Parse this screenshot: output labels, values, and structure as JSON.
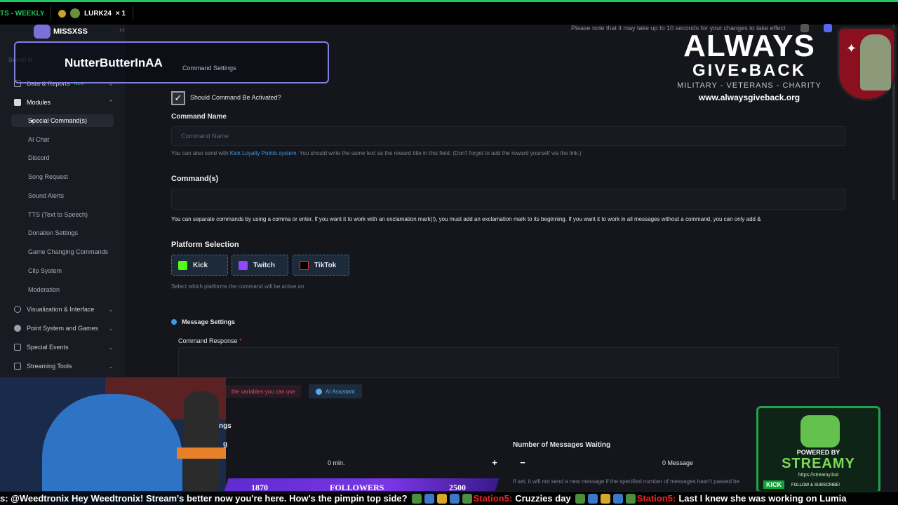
{
  "topbar": {
    "weekly_label": "TS - WEEKLY",
    "lurk_label": "LURK24",
    "lurk_count": "× 1"
  },
  "sidebar": {
    "brand": "MISSXSS",
    "search_placeholder": "Search M",
    "data_reports": "Data & Reports",
    "data_reports_badge": "New",
    "modules": "Modules",
    "items": [
      "Special Command(s)",
      "AI Chat",
      "Discord",
      "Song Request",
      "Sound Alerts",
      "TTS (Text to Speech)",
      "Donation Settings",
      "Game Changing Commands",
      "Clip System",
      "Moderation"
    ],
    "sections": [
      "Visualization & Interface",
      "Point System and Games",
      "Special Events",
      "Streaming Tools"
    ]
  },
  "main": {
    "notice": "Please note that it may take up to 10 seconds for your changes to take effect",
    "breadcrumb": "Command Settings",
    "activate_label": "Should Command Be Activated?",
    "command_name_label": "Command Name",
    "command_name_placeholder": "Command Name",
    "help1_pre": "You can also send with",
    "help1_link": "Kick Loyalty Points system",
    "help1_post": ". You should write the same text as the reward title in this field. (Don't forget to add the reward yourself via the link.)",
    "commands_label": "Command(s)",
    "commands_help": "You can separate commands by using a comma or enter. If you want it to work with an exclamation mark(!), you must add an exclamation mark to its beginning. If you want it to work in all messages without a command, you can only add &",
    "platform_label": "Platform Selection",
    "platforms": [
      "Kick",
      "Twitch",
      "TikTok"
    ],
    "platform_help": "Select which platforms the command will be active on",
    "message_settings": "Message Settings",
    "command_response_label": "Command Response",
    "required_mark": "*",
    "variables_link": "the variables you can use",
    "ai_assistant": "AI Assistant",
    "settings_frag": "ngs",
    "settings_frag2": "g",
    "min_value": "0 min.",
    "messages_waiting_label": "Number of Messages Waiting",
    "message_value": "0 Message",
    "messages_help": "If set, it will not send a new message if the specified number of messages hasn't passed be"
  },
  "overlay": {
    "username": "NutterButterInAA",
    "agb_line1": "ALWAYS",
    "agb_line2": "GIVE•BACK",
    "agb_line3": "MILITARY - VETERANS - CHARITY",
    "agb_url": "www.alwaysgiveback.org",
    "followers_left": "1870",
    "followers_label": "FOLLOWERS",
    "followers_right": "2500",
    "streamy_powered": "POWERED BY",
    "streamy_name": "STREAMY",
    "streamy_url": "https://streamy.bot",
    "kick_badge": "KICK",
    "follow_sub": "FOLLOW & SUBSCRIBE!"
  },
  "ticker": {
    "seg1": "s: @Weedtronix Hey Weedtronix! Stream's better now you're here. How's the pimpin top side?",
    "seg2": "Station5:",
    "seg3": "Cruzzies day",
    "seg4": "Station5:",
    "seg5": "Last I knew she was working on Lumia"
  },
  "colors": {
    "accent_green": "#22c55e",
    "link_blue": "#3b9ce6",
    "kick_green": "#53fc18",
    "twitch_purple": "#9146ff",
    "required_red": "#e0455a"
  }
}
